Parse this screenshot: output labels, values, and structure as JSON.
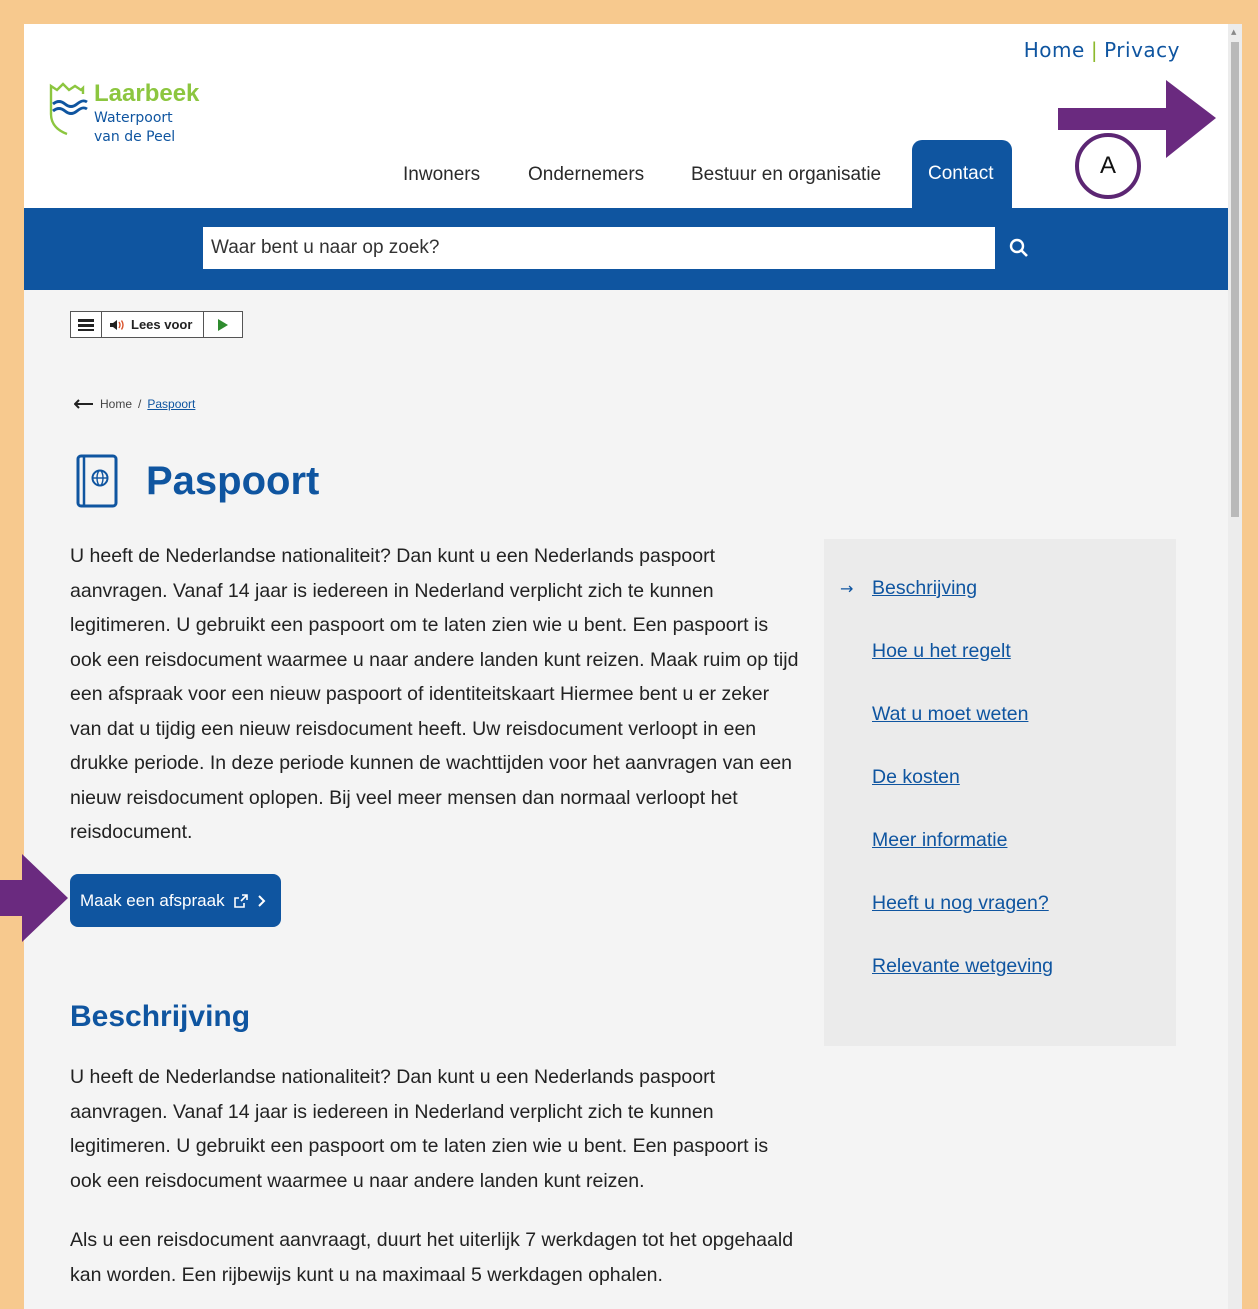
{
  "header": {
    "top_links": [
      "Home",
      "Privacy"
    ],
    "logo": {
      "name": "Laarbeek",
      "tagline_line1": "Waterpoort",
      "tagline_line2": "van de Peel"
    },
    "nav": [
      "Inwoners",
      "Ondernemers",
      "Bestuur en organisatie",
      "Contact"
    ],
    "active_nav": "Contact"
  },
  "search": {
    "placeholder": "Waar bent u naar op zoek?",
    "icon": "search-icon"
  },
  "readspeaker": {
    "label": "Lees voor"
  },
  "breadcrumb": {
    "home": "Home",
    "separator": "/",
    "current": "Paspoort"
  },
  "page": {
    "title": "Paspoort",
    "intro": "U heeft de Nederlandse nationaliteit? Dan kunt u een Nederlands paspoort aanvragen. Vanaf 14 jaar is iedereen in Nederland verplicht zich te kunnen legitimeren. U gebruikt een paspoort om te laten zien wie u bent. Een paspoort is ook een reisdocument waarmee u naar andere landen kunt reizen. Maak ruim op tijd een afspraak voor een nieuw paspoort of identiteitskaart Hiermee bent u er zeker van dat u tijdig een nieuw reisdocument heeft. Uw reisdocument verloopt in een drukke periode. In deze periode kunnen de wachttijden voor het aanvragen van een nieuw reisdocument oplopen. Bij veel meer mensen dan normaal verloopt het reisdocument.",
    "cta_label": "Maak een afspraak",
    "section_heading": "Beschrijving",
    "section_p1": "U heeft de Nederlandse nationaliteit? Dan kunt u een Nederlands paspoort aanvragen. Vanaf 14 jaar is iedereen in Nederland verplicht zich te kunnen legitimeren. U gebruikt een paspoort om te laten zien wie u bent. Een paspoort is ook een reisdocument waarmee u naar andere landen kunt reizen.",
    "section_p2": "Als u een reisdocument aanvraagt, duurt het uiterlijk 7 werkdagen tot het opgehaald kan worden. Een rijbewijs kunt u na maximaal 5 werkdagen ophalen."
  },
  "toc": {
    "items": [
      "Beschrijving",
      "Hoe u het regelt",
      "Wat u moet weten",
      "De kosten",
      "Meer informatie",
      "Heeft u nog vragen?",
      "Relevante wetgeving"
    ],
    "active": "Beschrijving"
  },
  "annotations": {
    "marker_label": "A"
  },
  "colors": {
    "brand_blue": "#0f55a0",
    "brand_green": "#8cc63f",
    "annotation_purple": "#6a2a7f",
    "frame": "#f7c98e"
  }
}
